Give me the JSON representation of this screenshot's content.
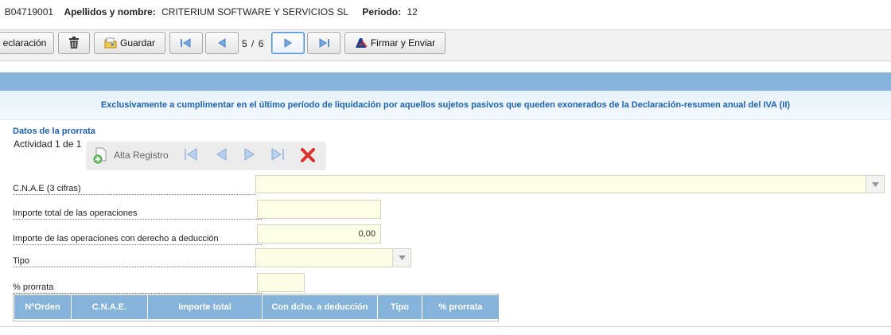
{
  "header": {
    "id_prefix": ":",
    "nif": "B04719001",
    "name_label": "Apellidos y nombre:",
    "name_value": "CRITERIUM SOFTWARE Y SERVICIOS SL",
    "period_label": "Periodo:",
    "period_value": "12"
  },
  "toolbar": {
    "declaracion_label": "eclaración",
    "save_label": "Guardar",
    "page_current": "5",
    "page_sep": "/",
    "page_total": "6",
    "sign_label": "Firmar y Enviar"
  },
  "notice": {
    "text": "Exclusivamente a cumplimentar en el último período de liquidación por aquellos sujetos pasivos que queden exonerados de la Declaración-resumen anual del IVA (II)"
  },
  "section": {
    "title": "Datos de la prorrata",
    "activity": "Actividad 1 de 1"
  },
  "mini_toolbar": {
    "alta_label": "Alta Registro"
  },
  "form": {
    "cnae_label": "C.N.A.E (3 cifras)",
    "cnae_value": "",
    "importe_total_label": "Importe total de las operaciones",
    "importe_total_value": "",
    "importe_deduccion_label": "Importe de las operaciones con derecho a deducción",
    "importe_deduccion_value": "0,00",
    "tipo_label": "Tipo",
    "tipo_value": "",
    "prorrata_label": "% prorrata",
    "prorrata_value": ""
  },
  "table": {
    "columns": [
      "NºOrden",
      "C.N.A.E.",
      "Importe total",
      "Con dcho. a deducción",
      "Tipo",
      "% prorrata"
    ],
    "rows": []
  },
  "colors": {
    "band": "#86b3da",
    "notice_text": "#1e62b0",
    "field_bg": "#fdfde6"
  }
}
